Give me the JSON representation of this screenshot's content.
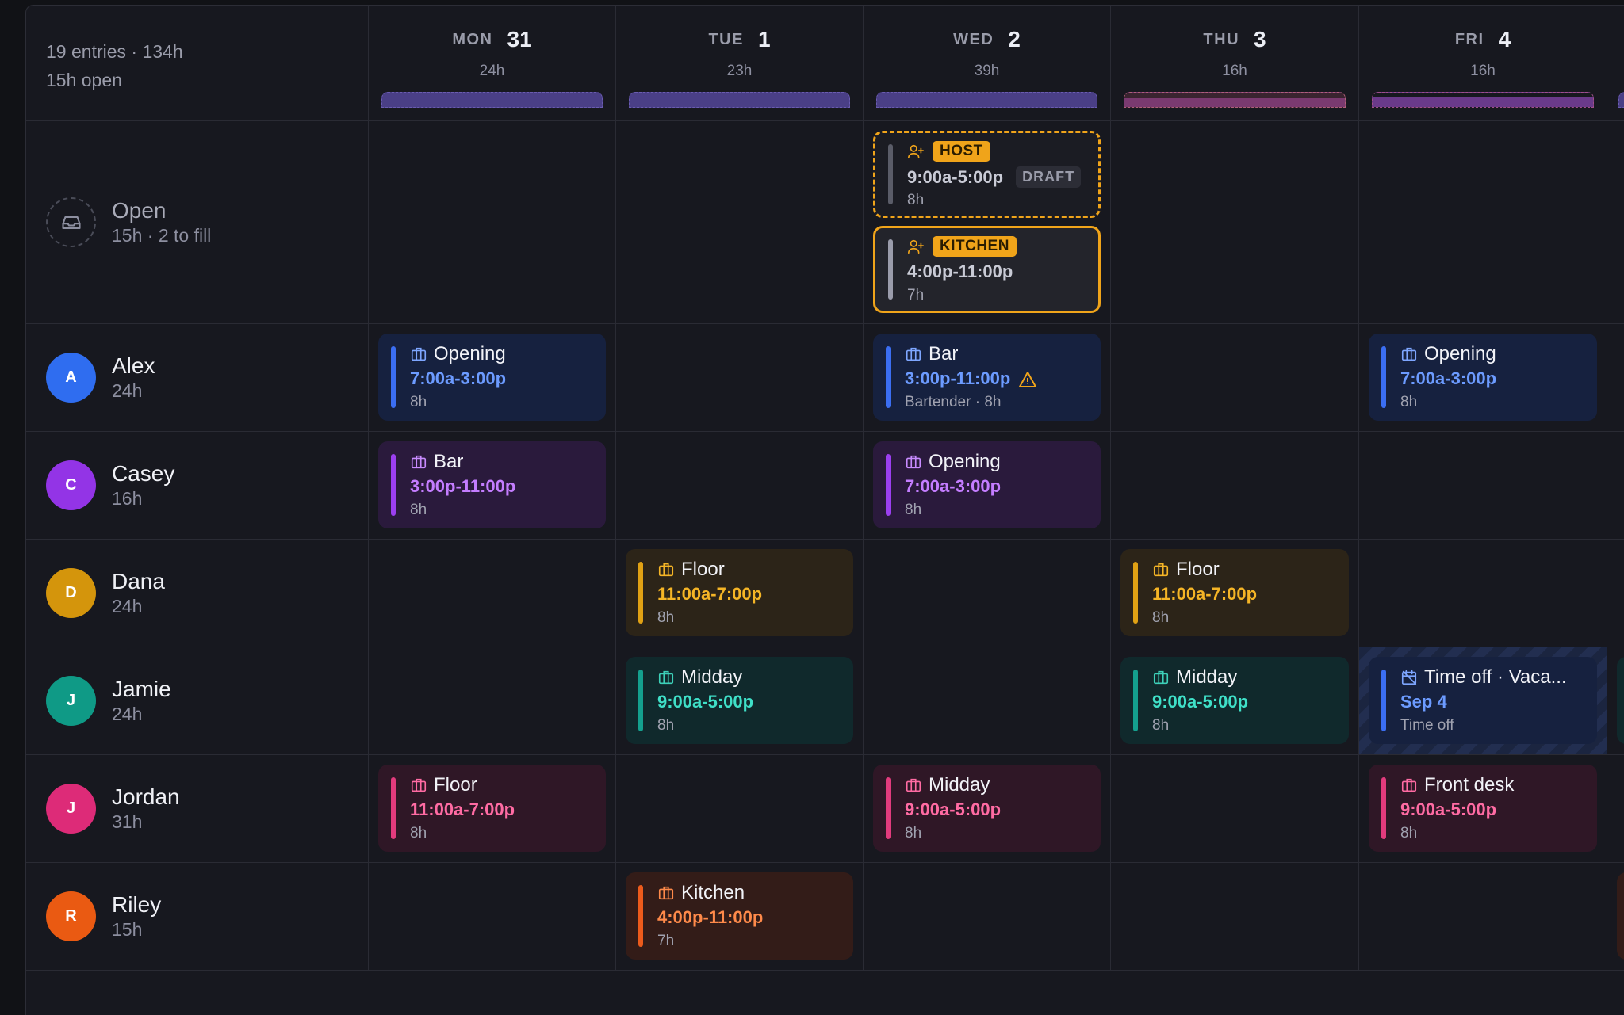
{
  "summary": {
    "line1": "19 entries · 134h",
    "line2": "15h open"
  },
  "days": [
    {
      "name": "MON",
      "num": "31",
      "hours": "24h"
    },
    {
      "name": "TUE",
      "num": "1",
      "hours": "23h"
    },
    {
      "name": "WED",
      "num": "2",
      "hours": "39h"
    },
    {
      "name": "THU",
      "num": "3",
      "hours": "16h"
    },
    {
      "name": "FRI",
      "num": "4",
      "hours": "16h"
    }
  ],
  "open_row": {
    "name": "Open",
    "sub": "15h · 2 to fill",
    "shifts": [
      {
        "role": "HOST",
        "time": "9:00a-5:00p",
        "status": "DRAFT",
        "hours": "8h"
      },
      {
        "role": "KITCHEN",
        "time": "4:00p-11:00p",
        "hours": "7h"
      }
    ]
  },
  "people": [
    {
      "initial": "A",
      "name": "Alex",
      "hours": "24h",
      "color": "#2f6df0"
    },
    {
      "initial": "C",
      "name": "Casey",
      "hours": "16h",
      "color": "#9334e6"
    },
    {
      "initial": "D",
      "name": "Dana",
      "hours": "24h",
      "color": "#d4950c"
    },
    {
      "initial": "J",
      "name": "Jamie",
      "hours": "24h",
      "color": "#0f9a86"
    },
    {
      "initial": "J",
      "name": "Jordan",
      "hours": "31h",
      "color": "#dd2b78"
    },
    {
      "initial": "R",
      "name": "Riley",
      "hours": "15h",
      "color": "#ea5a12"
    }
  ],
  "shifts": {
    "alex_mon": {
      "title": "Opening",
      "time": "7:00a-3:00p",
      "meta": "8h"
    },
    "alex_wed": {
      "title": "Bar",
      "time": "3:00p-11:00p",
      "meta": "Bartender · 8h"
    },
    "alex_fri": {
      "title": "Opening",
      "time": "7:00a-3:00p",
      "meta": "8h"
    },
    "casey_mon": {
      "title": "Bar",
      "time": "3:00p-11:00p",
      "meta": "8h"
    },
    "casey_wed": {
      "title": "Opening",
      "time": "7:00a-3:00p",
      "meta": "8h"
    },
    "dana_tue": {
      "title": "Floor",
      "time": "11:00a-7:00p",
      "meta": "8h"
    },
    "dana_thu": {
      "title": "Floor",
      "time": "11:00a-7:00p",
      "meta": "8h"
    },
    "jamie_tue": {
      "title": "Midday",
      "time": "9:00a-5:00p",
      "meta": "8h"
    },
    "jamie_thu": {
      "title": "Midday",
      "time": "9:00a-5:00p",
      "meta": "8h"
    },
    "jamie_fri": {
      "title": "Time off · Vaca...",
      "time": "Sep 4",
      "meta": "Time off"
    },
    "jordan_mon": {
      "title": "Floor",
      "time": "11:00a-7:00p",
      "meta": "8h"
    },
    "jordan_wed": {
      "title": "Midday",
      "time": "9:00a-5:00p",
      "meta": "8h"
    },
    "jordan_fri": {
      "title": "Front desk",
      "time": "9:00a-5:00p",
      "meta": "8h"
    },
    "riley_tue": {
      "title": "Kitchen",
      "time": "4:00p-11:00p",
      "meta": "7h"
    }
  },
  "colors": {
    "accent_open": "#f0a41a",
    "blue": "#3b6ef2",
    "purple": "#9b3ff0",
    "amber": "#e0a114",
    "teal": "#14a08e",
    "pink": "#e23b7d",
    "orange": "#ec5b1c"
  },
  "icons": {
    "shift": "briefcase-icon",
    "open": "inbox-icon",
    "open_shift": "user-plus-icon",
    "warning": "warning-icon",
    "time_off": "calendar-off-icon"
  }
}
